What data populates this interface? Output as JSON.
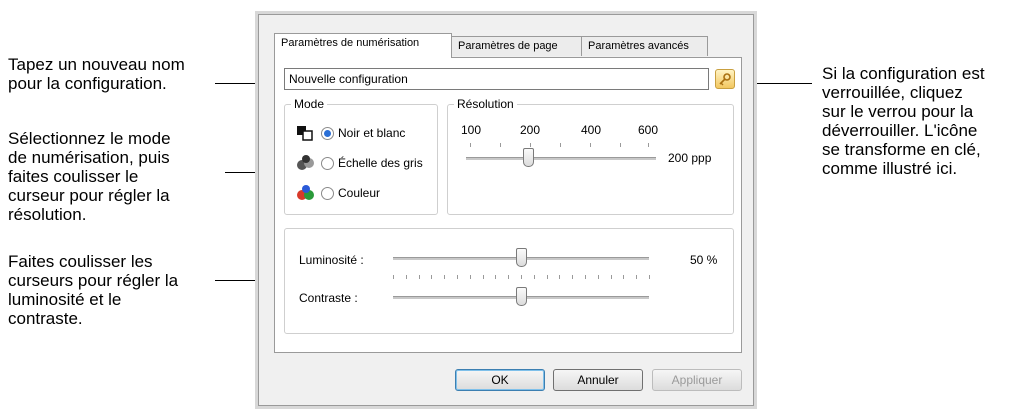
{
  "callouts": {
    "left1": [
      "Tapez un nouveau nom",
      "pour la configuration."
    ],
    "left2": [
      "Sélectionnez le mode",
      "de numérisation, puis",
      "faites coulisser le",
      "curseur pour régler la",
      "résolution."
    ],
    "left3": [
      "Faites coulisser les",
      "curseurs pour régler la",
      "luminosité et le",
      "contraste."
    ],
    "right": [
      "Si la configuration est",
      "verrouillée, cliquez",
      "sur le verrou pour la",
      "déverrouiller. L'icône",
      "se transforme en clé,",
      "comme illustré ici."
    ]
  },
  "dialog": {
    "tabs": [
      "Paramètres de numérisation",
      "Paramètres de page",
      "Paramètres avancés"
    ],
    "config_name": "Nouvelle configuration",
    "lock_icon": "key-icon",
    "mode": {
      "legend": "Mode",
      "options": [
        "Noir et blanc",
        "Échelle des gris",
        "Couleur"
      ],
      "selected": 0
    },
    "resolution": {
      "legend": "Résolution",
      "ticks": [
        "100",
        "200",
        "400",
        "600"
      ],
      "value_text": "200 ppp",
      "position_fraction": 0.33
    },
    "brightness": {
      "label": "Luminosité :",
      "value_text": "50 %",
      "position_fraction": 0.5
    },
    "contrast": {
      "label": "Contraste :",
      "position_fraction": 0.5
    },
    "buttons": {
      "ok": "OK",
      "cancel": "Annuler",
      "apply": "Appliquer"
    }
  }
}
